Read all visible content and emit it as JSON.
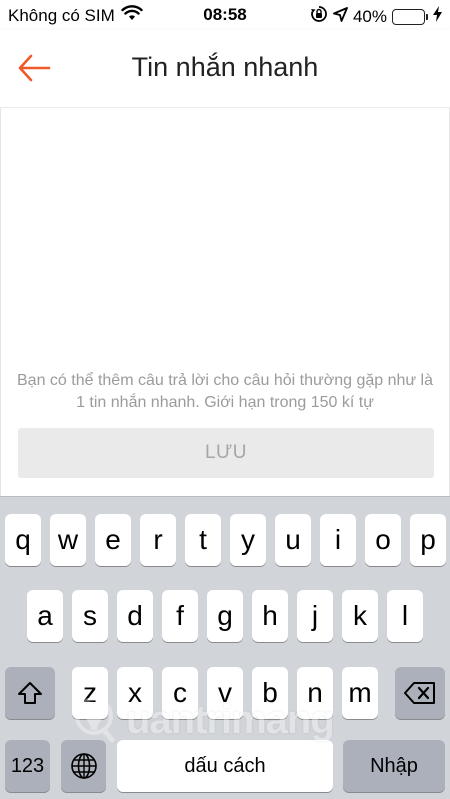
{
  "status_bar": {
    "carrier": "Không có SIM",
    "time": "08:58",
    "battery_percent": "40%",
    "battery_level": 0.4,
    "icons": [
      "wifi-icon",
      "orientation-lock-icon",
      "location-icon",
      "battery-icon",
      "charging-icon"
    ]
  },
  "header": {
    "title": "Tin nhắn nhanh",
    "back_icon": "arrow-left-icon",
    "accent_color": "#f05a28"
  },
  "main": {
    "hint": "Bạn có thể thêm câu trả lời cho câu hỏi thường gặp như là 1 tin nhắn nhanh. Giới hạn trong 150 kí tự",
    "save_label": "LƯU"
  },
  "keyboard": {
    "row1": [
      "q",
      "w",
      "e",
      "r",
      "t",
      "y",
      "u",
      "i",
      "o",
      "p"
    ],
    "row2": [
      "a",
      "s",
      "d",
      "f",
      "g",
      "h",
      "j",
      "k",
      "l"
    ],
    "row3": [
      "z",
      "x",
      "c",
      "v",
      "b",
      "n",
      "m"
    ],
    "numbers_label": "123",
    "space_label": "dấu cách",
    "return_label": "Nhập",
    "shift_icon": "shift-icon",
    "globe_icon": "globe-icon",
    "delete_icon": "backspace-icon"
  },
  "watermark": {
    "text": "uantrimang"
  }
}
